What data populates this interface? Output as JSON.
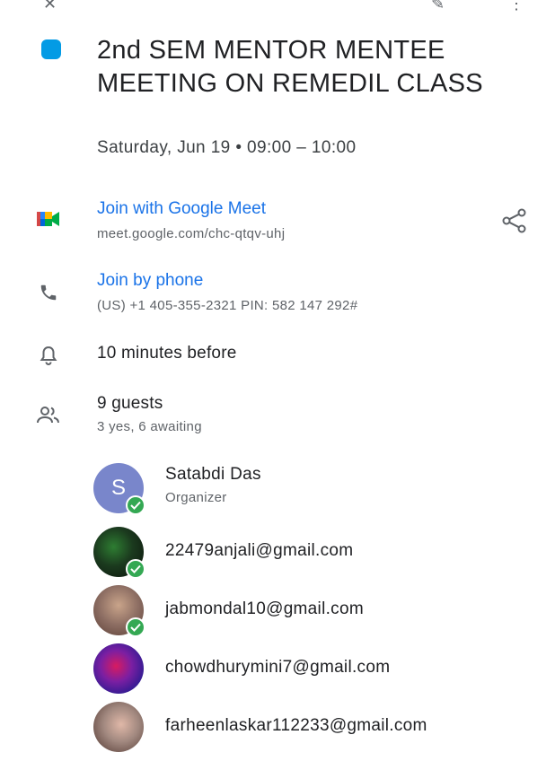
{
  "event": {
    "title": "2nd SEM MENTOR MENTEE MEETING ON REMEDIL CLASS",
    "datetime": "Saturday, Jun 19  •  09:00 – 10:00",
    "color": "#039be5"
  },
  "meet": {
    "label": "Join with Google Meet",
    "url": "meet.google.com/chc-qtqv-uhj"
  },
  "phone": {
    "label": "Join by phone",
    "details": "(US) +1 405-355-2321 PIN: 582 147 292#"
  },
  "reminder": {
    "text": "10 minutes before"
  },
  "guests": {
    "count_label": "9 guests",
    "summary": "3 yes, 6 awaiting",
    "list": [
      {
        "name": "Satabdi Das",
        "role": "Organizer",
        "initial": "S",
        "accepted": true
      },
      {
        "name": "22479anjali@gmail.com",
        "accepted": true
      },
      {
        "name": "jabmondal10@gmail.com",
        "accepted": true
      },
      {
        "name": "chowdhurymini7@gmail.com",
        "accepted": false
      },
      {
        "name": "farheenlaskar112233@gmail.com",
        "accepted": false
      }
    ]
  },
  "icons": {
    "close": "close-icon",
    "edit": "edit-icon",
    "more": "more-vert-icon",
    "meet": "google-meet-icon",
    "share": "share-icon",
    "phone": "phone-icon",
    "bell": "bell-icon",
    "guests": "people-icon"
  }
}
